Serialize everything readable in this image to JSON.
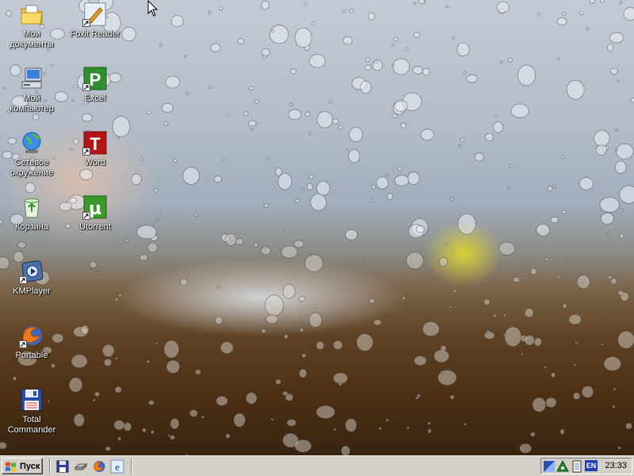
{
  "desktop": {
    "icons": [
      {
        "label": "Мои\nдокументы",
        "icon": "my-documents-folder-icon",
        "shortcut": false
      },
      {
        "label": "Foxit Reader",
        "icon": "foxit-reader-icon",
        "shortcut": true
      },
      {
        "label": "Мой\nкомпьютер",
        "icon": "my-computer-icon",
        "shortcut": false
      },
      {
        "label": "Excel",
        "icon": "excel-icon",
        "shortcut": true,
        "glyph": "P"
      },
      {
        "label": "Сетевое\nокружение",
        "icon": "network-places-icon",
        "shortcut": false
      },
      {
        "label": "Word",
        "icon": "word-icon",
        "shortcut": true,
        "glyph": "T"
      },
      {
        "label": "Корзина",
        "icon": "recycle-bin-icon",
        "shortcut": false
      },
      {
        "label": "Utorrent",
        "icon": "utorrent-icon",
        "shortcut": true,
        "glyph": "µ"
      },
      {
        "label": "KMPlayer",
        "icon": "kmplayer-icon",
        "shortcut": true
      },
      {
        "label": "Portable",
        "icon": "firefox-portable-icon",
        "shortcut": true
      },
      {
        "label": "Total\nCommander",
        "icon": "total-commander-icon",
        "shortcut": false
      }
    ]
  },
  "taskbar": {
    "start_label": "Пуск",
    "quick_launch": [
      "floppy-save-icon",
      "disk-drive-icon",
      "firefox-icon",
      "internet-explorer-icon"
    ],
    "tray": {
      "icons": [
        "display-properties-icon",
        "network-alert-icon",
        "document-icon"
      ],
      "language": "EN",
      "time": "23:33"
    }
  },
  "colors": {
    "taskbar_bg": "#d4d0c8",
    "excel_green": "#2f8f2f",
    "word_red": "#b31515",
    "utorrent_green": "#3a9a2a",
    "lang_blue": "#1f3fa8"
  }
}
